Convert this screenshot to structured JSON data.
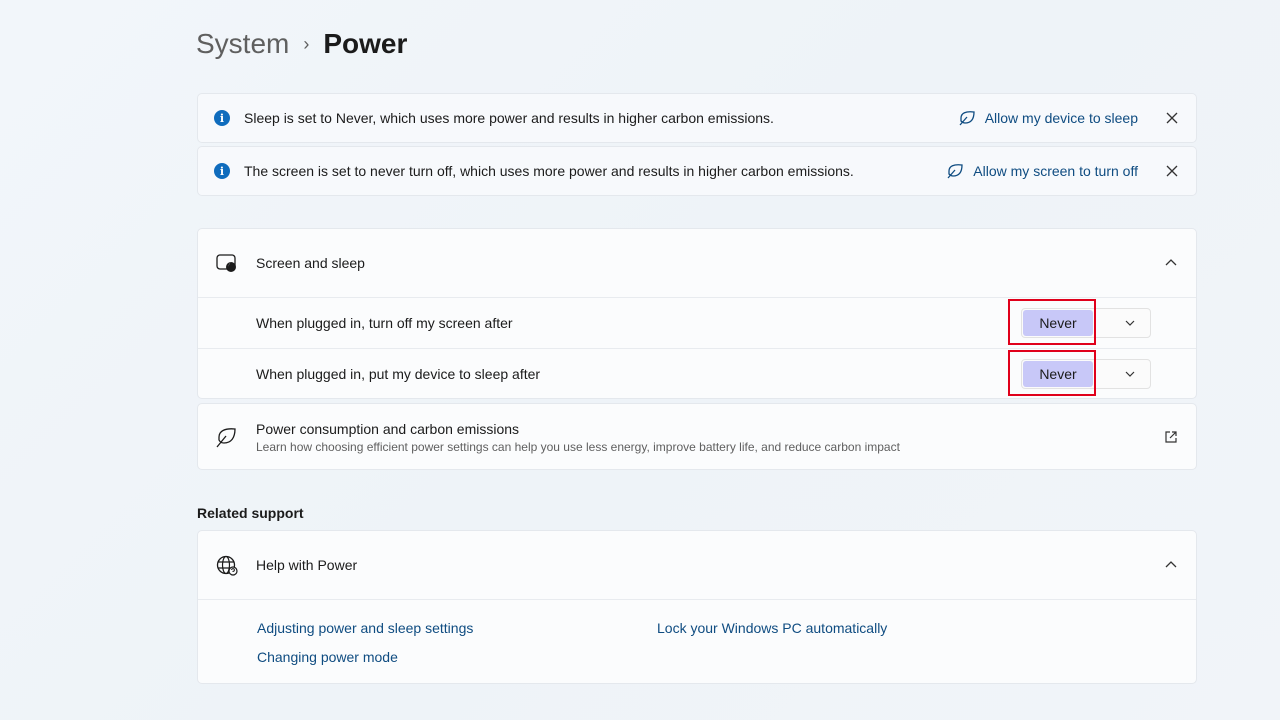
{
  "breadcrumb": {
    "parent": "System",
    "separator": "›",
    "current": "Power"
  },
  "banners": [
    {
      "message": "Sleep is set to Never, which uses more power and results in higher carbon emissions.",
      "action": "Allow my device to sleep"
    },
    {
      "message": "The screen is set to never turn off, which uses more power and results in higher carbon emissions.",
      "action": "Allow my screen to turn off"
    }
  ],
  "screen_sleep": {
    "title": "Screen and sleep",
    "rows": [
      {
        "label": "When plugged in, turn off my screen after",
        "value": "Never"
      },
      {
        "label": "When plugged in, put my device to sleep after",
        "value": "Never"
      }
    ]
  },
  "power_consumption": {
    "title": "Power consumption and carbon emissions",
    "description": "Learn how choosing efficient power settings can help you use less energy, improve battery life, and reduce carbon impact"
  },
  "related_support": {
    "heading": "Related support",
    "help": {
      "title": "Help with Power",
      "links": [
        "Adjusting power and sleep settings",
        "Lock your Windows PC automatically",
        "Changing power mode"
      ]
    }
  },
  "colors": {
    "accent": "#0f6cbd",
    "link": "#0f4c81",
    "highlight_border": "#e0001b",
    "selected_fill": "#c8c8f8"
  }
}
